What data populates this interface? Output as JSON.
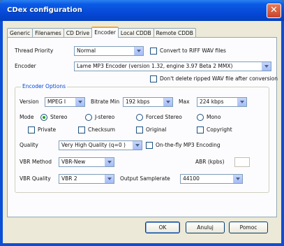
{
  "window": {
    "title": "CDex configuration",
    "close_symbol": "✕"
  },
  "tabs": [
    "Generic",
    "Filenames",
    "CD Drive",
    "Encoder",
    "Local CDDB",
    "Remote CDDB"
  ],
  "active_tab_index": 3,
  "encoder": {
    "thread_priority_label": "Thread Priority",
    "thread_priority_value": "Normal",
    "convert_riff_label": "Convert to RIFF WAV files",
    "encoder_label": "Encoder",
    "encoder_value": "Lame MP3 Encoder (version 1.32, engine 3.97 Beta 2 MMX)",
    "dont_delete_label": "Don't delete ripped WAV file after conversion"
  },
  "options": {
    "group_title": "Encoder Options",
    "version_label": "Version",
    "version_value": "MPEG I",
    "bitrate_min_label": "Bitrate Min",
    "bitrate_min_value": "192 kbps",
    "max_label": "Max",
    "max_value": "224 kbps",
    "mode_label": "Mode",
    "mode_options": [
      "Stereo",
      "J-stereo",
      "Forced Stereo",
      "Mono"
    ],
    "mode_selected_index": 0,
    "flags": [
      "Private",
      "Checksum",
      "Original",
      "Copyright"
    ],
    "quality_label": "Quality",
    "quality_value": "Very High Quality (q=0 )",
    "onthefly_label": "On-the-fly MP3 Encoding",
    "vbr_method_label": "VBR Method",
    "vbr_method_value": "VBR-New",
    "abr_label": "ABR (kpbs)",
    "abr_value": "",
    "vbr_quality_label": "VBR Quality",
    "vbr_quality_value": "VBR 2",
    "output_samplerate_label": "Output Samplerate",
    "output_samplerate_value": "44100"
  },
  "buttons": {
    "ok": "OK",
    "cancel": "Anuluj",
    "help": "Pomoc"
  },
  "colors": {
    "title_bar": "#0546d3",
    "dialog_bg": "#ece9d8",
    "group_title": "#0046d5"
  }
}
